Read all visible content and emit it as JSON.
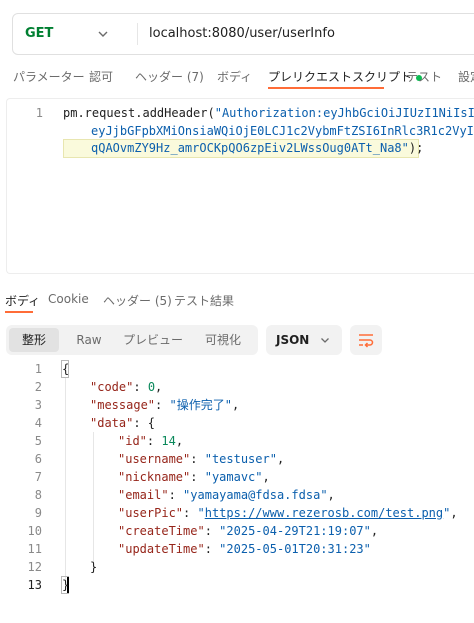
{
  "request": {
    "method": "GET",
    "url": "localhost:8080/user/userInfo"
  },
  "request_tabs": [
    {
      "label": "パラメーター"
    },
    {
      "label": "認可"
    },
    {
      "label": "ヘッダー",
      "count": "(7)"
    },
    {
      "label": "ボディ"
    },
    {
      "label": "プレリクエストスクリプト",
      "active": true,
      "status_dot": true
    },
    {
      "label": "テスト"
    },
    {
      "label": "設定"
    }
  ],
  "script": {
    "line_number": "1",
    "lines": [
      {
        "fn": "pm.request.addHeader(",
        "str": "\"Authorization:eyJhbGciOiJIUzI1NiIsIn"
      },
      {
        "fn": "",
        "str": "eyJjbGFpbXMiOnsiaWQiOjE0LCJ1c2VybmFtZSI6InRlc3R1c2VyIi"
      },
      {
        "fn": "",
        "str": "qQAOvmZY9Hz_amrOCKpQO6zpEiv2LWssOug0ATt_Na8\"",
        "tail": ");"
      }
    ]
  },
  "response_tabs": [
    {
      "label": "ボディ",
      "active": true
    },
    {
      "label": "Cookie"
    },
    {
      "label": "ヘッダー",
      "count": "(5)"
    },
    {
      "label": "テスト結果"
    }
  ],
  "view_modes": [
    {
      "label": "整形",
      "active": true
    },
    {
      "label": "Raw"
    },
    {
      "label": "プレビュー"
    },
    {
      "label": "可視化"
    }
  ],
  "format": "JSON",
  "response_body": {
    "line_numbers": [
      "1",
      "2",
      "3",
      "4",
      "5",
      "6",
      "7",
      "8",
      "9",
      "10",
      "11",
      "12",
      "13"
    ],
    "code": 0,
    "message": "操作完了",
    "data": {
      "id": 14,
      "username": "testuser",
      "nickname": "yamavc",
      "email": "yamayama@fdsa.fdsa",
      "userPic": "https://www.rezerosb.com/test.png",
      "createTime": "2025-04-29T21:19:07",
      "updateTime": "2025-05-01T20:31:23"
    }
  },
  "colors": {
    "accent": "#ff6c37",
    "method_get": "#007f31",
    "status_dot": "#0cbb52",
    "json_key": "#96251a",
    "json_string": "#0b5fad",
    "json_number": "#09885a"
  },
  "icons": {
    "method_dropdown": "chevron-down-icon",
    "format_dropdown": "chevron-down-icon",
    "wrap": "wrap-lines-icon"
  }
}
